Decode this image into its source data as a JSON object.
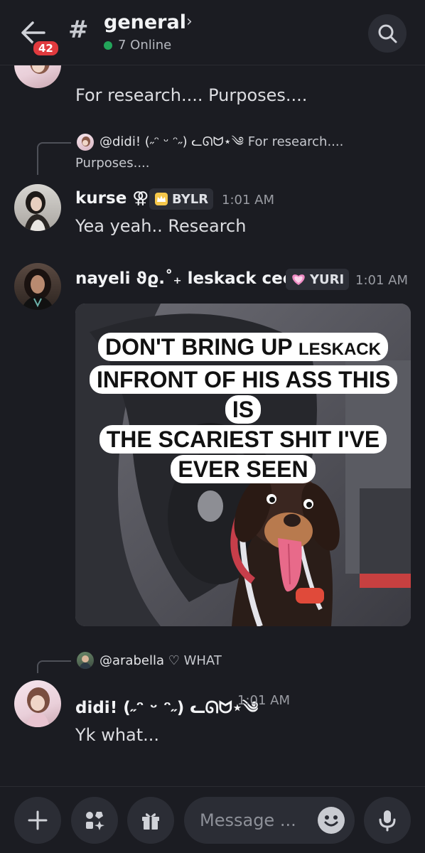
{
  "header": {
    "unread_count": "42",
    "channel_hash": "#",
    "channel_name": "general",
    "chevron": "›",
    "online_status": "7 Online"
  },
  "messages": [
    {
      "id": "m0",
      "text": "For research.... Purposes...."
    },
    {
      "id": "m1",
      "reply_to": {
        "author": "@didi! (˶ᵔ ᵕ ᵔ˶) ᓚᘏᗢ⋆༄",
        "text_line1": "For research....",
        "text_line2": "Purposes...."
      },
      "author": "kurse ⚢",
      "tag_icon": "crown-badge-icon",
      "tag": "BYLR",
      "time": "1:01 AM",
      "text": "Yea yeah.. Research"
    },
    {
      "id": "m2",
      "author": "nayeli ϑϱ.˚₊ leskack ceo",
      "tag_icon": "pink-heart-icon",
      "tag": "YURI",
      "time": "1:01 AM",
      "image": {
        "caption_line1": "DON'T BRING UP",
        "caption_small": "LESKACK",
        "caption_line2": "INFRONT OF HIS ASS THIS IS",
        "caption_line3": "THE SCARIEST SHIT I'VE",
        "caption_line4": "EVER SEEN"
      }
    },
    {
      "id": "m3",
      "reply_to": {
        "author": "@arabella",
        "text": "♡ WHAT"
      },
      "author": "didi! (˶ᵔ ᵕ ᵔ˶) ᓚᘏᗢ⋆༄",
      "time": "1:01 AM",
      "text": "Yk what..."
    }
  ],
  "composer": {
    "placeholder": "Message ..."
  },
  "colors": {
    "background": "#1b1c22",
    "badge": "#e03a3e",
    "online": "#23a55a"
  }
}
